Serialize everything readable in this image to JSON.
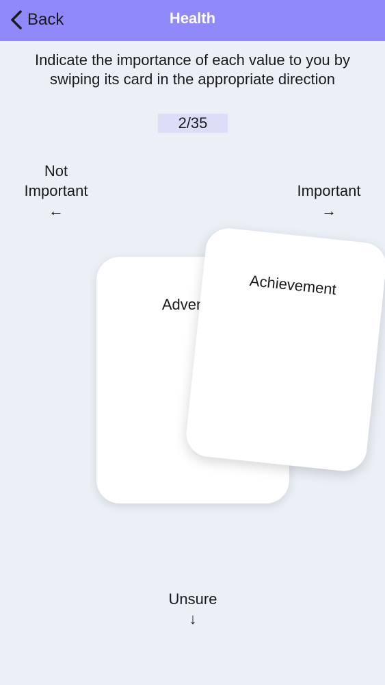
{
  "nav": {
    "back_label": "Back",
    "title": "Health"
  },
  "instructions": "Indicate the importance of each value to you by swiping its card in the appropriate direction",
  "progress": {
    "text": "2/35",
    "current": 2,
    "total": 35
  },
  "directions": {
    "left": {
      "label": "Not Important",
      "arrow": "←"
    },
    "right": {
      "label": "Important",
      "arrow": "→"
    },
    "down": {
      "label": "Unsure",
      "arrow": "↓"
    }
  },
  "cards": {
    "back": "Adventure",
    "front": "Achievement"
  },
  "colors": {
    "nav_bg": "#9089FB",
    "page_bg": "#EBF0F7",
    "counter_bg": "#DBDEF6"
  }
}
